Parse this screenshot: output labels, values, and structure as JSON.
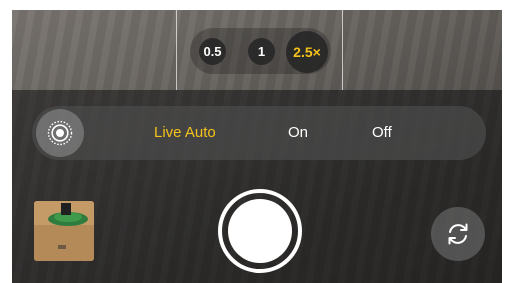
{
  "zoom": {
    "options": [
      "0.5",
      "1",
      "2.5×"
    ],
    "selected": "2.5×"
  },
  "live_photo": {
    "icon": "live-photo-icon",
    "options": [
      "Live Auto",
      "On",
      "Off"
    ],
    "selected": "Live Auto"
  },
  "controls": {
    "thumbnail_icon": "photo-thumbnail",
    "shutter_icon": "shutter-button",
    "flip_icon": "camera-flip-icon"
  },
  "colors": {
    "accent": "#f5c21b",
    "text": "#ffffff"
  }
}
